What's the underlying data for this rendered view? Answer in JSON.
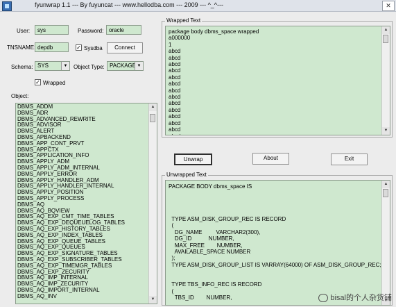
{
  "window": {
    "title": "fyunwrap 1.1 --- By fuyuncat --- www.hellodba.com --- 2009 --- ^_^---",
    "close_glyph": "✕",
    "icon": "app-icon"
  },
  "login": {
    "user_label": "User:",
    "user_value": "sys",
    "password_label": "Password:",
    "password_value": "oracle",
    "tnsname_label": "TNSNAME:",
    "tnsname_value": "depdb",
    "sysdba_label": "Sysdba",
    "sysdba_checked": true,
    "connect_label": "Connect",
    "check_glyph": "✓"
  },
  "filters": {
    "schema_label": "Schema:",
    "schema_value": "SYS",
    "object_type_label": "Object Type:",
    "object_type_value": "PACKAGE B",
    "wrapped_label": "Wrapped",
    "wrapped_checked": true,
    "dropdown_glyph": "▼"
  },
  "objects": {
    "label": "Object:",
    "items": [
      "DBMS_ADDM",
      "DBMS_ADR",
      "DBMS_ADVANCED_REWRITE",
      "DBMS_ADVISOR",
      "DBMS_ALERT",
      "DBMS_APBACKEND",
      "DBMS_APP_CONT_PRVT",
      "DBMS_APPCTX",
      "DBMS_APPLICATION_INFO",
      "DBMS_APPLY_ADM",
      "DBMS_APPLY_ADM_INTERNAL",
      "DBMS_APPLY_ERROR",
      "DBMS_APPLY_HANDLER_ADM",
      "DBMS_APPLY_HANDLER_INTERNAL",
      "DBMS_APPLY_POSITION",
      "DBMS_APPLY_PROCESS",
      "DBMS_AQ",
      "DBMS_AQ_BQVIEW",
      "DBMS_AQ_EXP_CMT_TIME_TABLES",
      "DBMS_AQ_EXP_DEQUEUELOG_TABLES",
      "DBMS_AQ_EXP_HISTORY_TABLES",
      "DBMS_AQ_EXP_INDEX_TABLES",
      "DBMS_AQ_EXP_QUEUE_TABLES",
      "DBMS_AQ_EXP_QUEUES",
      "DBMS_AQ_EXP_SIGNATURE_TABLES",
      "DBMS_AQ_EXP_SUBSCRIBER_TABLES",
      "DBMS_AQ_EXP_TIMEMGR_TABLES",
      "DBMS_AQ_EXP_ZECURITY",
      "DBMS_AQ_IMP_INTERNAL",
      "DBMS_AQ_IMP_ZECURITY",
      "DBMS_AQ_IMPORT_INTERNAL",
      "DBMS_AQ_INV"
    ]
  },
  "wrapped_text": {
    "title": "Wrapped Text",
    "lines": [
      "package body dbms_space wrapped",
      "a000000",
      "1",
      "abcd",
      "abcd",
      "abcd",
      "abcd",
      "abcd",
      "abcd",
      "abcd",
      "abcd",
      "abcd",
      "abcd",
      "abcd",
      "abcd",
      "abcd",
      "abcd",
      "abcd",
      "abcd"
    ]
  },
  "buttons": {
    "unwrap": "Unwrap",
    "about": "About",
    "exit": "Exit"
  },
  "unwrapped_text": {
    "title": "Unwrapped Text",
    "lines": [
      "PACKAGE BODY dbms_space IS",
      "",
      "",
      "",
      "",
      "  TYPE ASM_DISK_GROUP_REC IS RECORD",
      "  (",
      "    DG_NAME         VARCHAR2(300),",
      "    DG_ID           NUMBER,",
      "    MAX_FREE        NUMBER,",
      "    AVAILABLE_SPACE NUMBER",
      "  );",
      "  TYPE ASM_DISK_GROUP_LIST IS VARRAY(64000) OF ASM_DISK_GROUP_REC;",
      "",
      "",
      "  TYPE TBS_INFO_REC IS RECORD",
      "  (",
      "    TBS_ID        NUMBER,"
    ]
  },
  "watermark": {
    "text": "bisal的个人杂货铺"
  },
  "scroll": {
    "up_glyph": "▲",
    "down_glyph": "▼"
  },
  "colors": {
    "field_bg": "#cfe8cf",
    "window_bg": "#ececec"
  }
}
